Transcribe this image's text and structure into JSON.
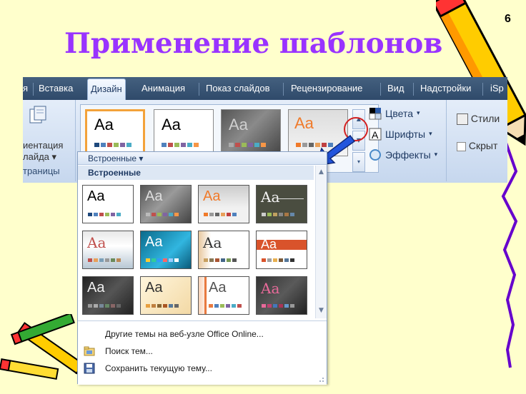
{
  "slide": {
    "title": "Применение шаблонов",
    "number": "6"
  },
  "ribbon": {
    "tabs": [
      {
        "label": "я"
      },
      {
        "label": "Вставка"
      },
      {
        "label": "Дизайн",
        "active": true
      },
      {
        "label": "Анимация"
      },
      {
        "label": "Показ слайдов"
      },
      {
        "label": "Рецензирование"
      },
      {
        "label": "Вид"
      },
      {
        "label": "Надстройки"
      },
      {
        "label": "iSp"
      }
    ],
    "page_setup": {
      "label_line1": "иентация",
      "label_line2": "лайда ▾",
      "group_label": "траницы"
    },
    "theme_options": {
      "colors": "Цвета",
      "fonts": "Шрифты",
      "effects": "Эффекты"
    },
    "background": {
      "styles": "Стили",
      "hide": "Скрыт"
    },
    "theme_tile_text": "Aa"
  },
  "gallery": {
    "header": "Встроенные ▾",
    "section_title": "Встроенные",
    "thumb_text": "Aa",
    "menu": {
      "online": "Другие темы на веб-узле Office Online...",
      "browse": "Поиск тем...",
      "save": "Сохранить текущую тему..."
    }
  },
  "colors": {
    "title": "#9933ff",
    "background": "#ffffcc",
    "highlight_circle": "#d42020",
    "arrow": "#2255dd"
  }
}
